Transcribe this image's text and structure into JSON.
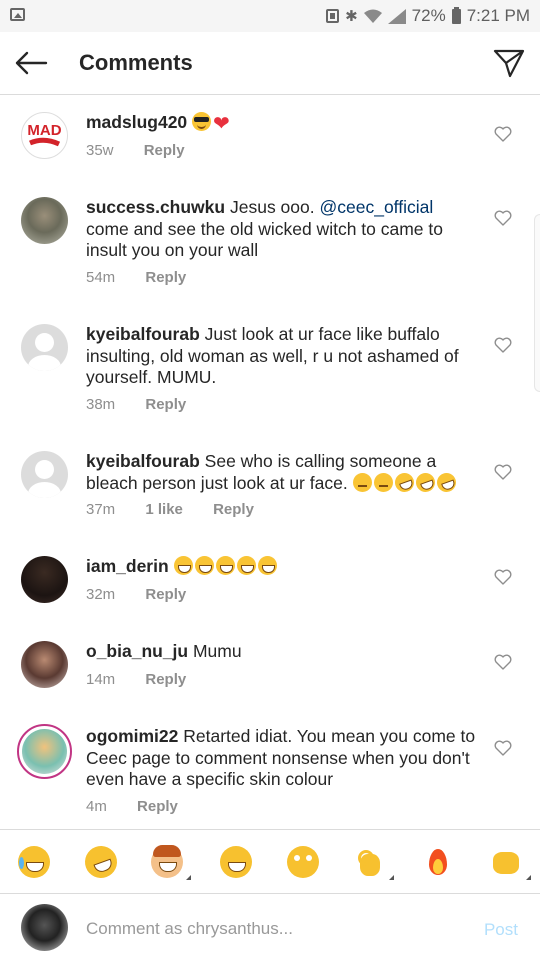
{
  "status_bar": {
    "battery": "72%",
    "time": "7:21 PM"
  },
  "header": {
    "title": "Comments",
    "back_icon": "arrow-left-icon",
    "share_icon": "paper-plane-icon"
  },
  "comments": [
    {
      "username": "madslug420",
      "text": "",
      "emojis": [
        "cool",
        "heart"
      ],
      "time": "35w",
      "likes": "",
      "reply": "Reply",
      "avatar_text": "MAD"
    },
    {
      "username": "success.chuwku",
      "text_before": "Jesus ooo. ",
      "mention": "@ceec_official",
      "text_after": " come and see the old wicked witch to came to insult you on your wall",
      "time": "54m",
      "reply": "Reply"
    },
    {
      "username": "kyeibalfourab",
      "text": "Just look at ur face like buffalo insulting, old woman as well, r u not ashamed of yourself. MUMU.",
      "time": "38m",
      "reply": "Reply"
    },
    {
      "username": "kyeibalfourab",
      "text": "See who is calling someone a bleach person just look at ur face.",
      "emojis": [
        "unamused",
        "unamused",
        "rofl",
        "rofl",
        "rofl"
      ],
      "time": "37m",
      "likes": "1 like",
      "reply": "Reply"
    },
    {
      "username": "iam_derin",
      "text": "",
      "emojis": [
        "grin",
        "grin",
        "grin",
        "grin",
        "grin"
      ],
      "time": "32m",
      "reply": "Reply"
    },
    {
      "username": "o_bia_nu_ju",
      "text": "Mumu",
      "time": "14m",
      "reply": "Reply"
    },
    {
      "username": "ogomimi22",
      "text": "Retarted idiat. You mean you come to Ceec page to comment nonsense when you don't even have a specific skin colour",
      "time": "4m",
      "reply": "Reply"
    }
  ],
  "composer": {
    "placeholder": "Comment as chrysanthus...",
    "post_label": "Post"
  },
  "colors": {
    "mention": "#003569",
    "post_disabled": "#b2dffc",
    "meta": "#8e8e8e"
  }
}
